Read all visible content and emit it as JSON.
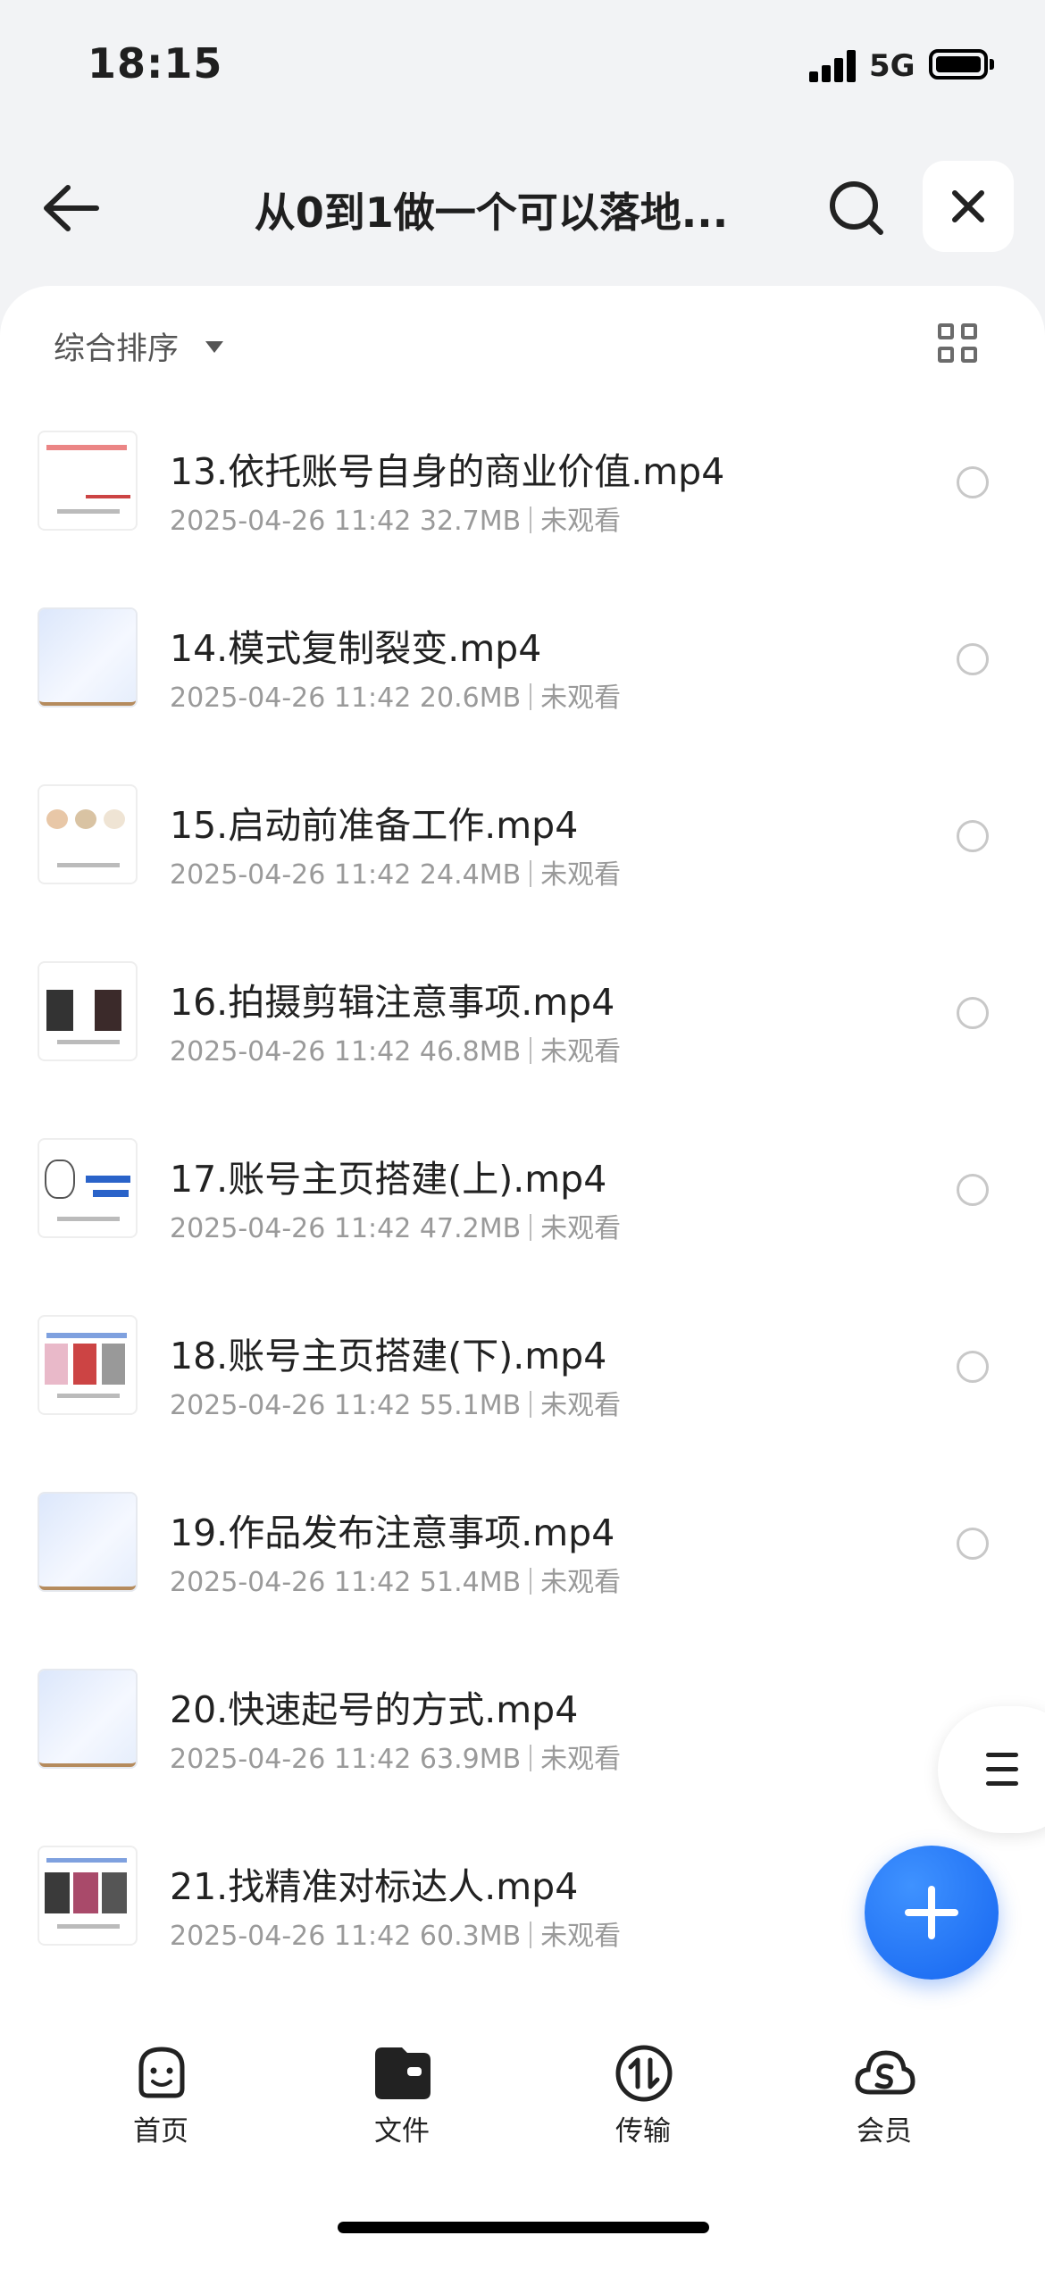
{
  "status": {
    "time": "18:15",
    "network": "5G"
  },
  "header": {
    "title": "从0到1做一个可以落地...",
    "back_icon": "arrow-left-icon",
    "search_icon": "search-icon",
    "close_icon": "close-icon"
  },
  "toolbar": {
    "sort_label": "综合排序"
  },
  "files": [
    {
      "name": "13.依托账号自身的商业价值.mp4",
      "date": "2025-04-26 11:42",
      "size": "32.7MB",
      "status": "未观看"
    },
    {
      "name": "14.模式复制裂变.mp4",
      "date": "2025-04-26 11:42",
      "size": "20.6MB",
      "status": "未观看"
    },
    {
      "name": "15.启动前准备工作.mp4",
      "date": "2025-04-26 11:42",
      "size": "24.4MB",
      "status": "未观看"
    },
    {
      "name": "16.拍摄剪辑注意事项.mp4",
      "date": "2025-04-26 11:42",
      "size": "46.8MB",
      "status": "未观看"
    },
    {
      "name": "17.账号主页搭建(上).mp4",
      "date": "2025-04-26 11:42",
      "size": "47.2MB",
      "status": "未观看"
    },
    {
      "name": "18.账号主页搭建(下).mp4",
      "date": "2025-04-26 11:42",
      "size": "55.1MB",
      "status": "未观看"
    },
    {
      "name": "19.作品发布注意事项.mp4",
      "date": "2025-04-26 11:42",
      "size": "51.4MB",
      "status": "未观看"
    },
    {
      "name": "20.快速起号的方式.mp4",
      "date": "2025-04-26 11:42",
      "size": "63.9MB",
      "status": "未观看"
    },
    {
      "name": "21.找精准对标达人.mp4",
      "date": "2025-04-26 11:42",
      "size": "60.3MB",
      "status": "未观看"
    }
  ],
  "tabs": [
    {
      "label": "首页",
      "icon": "smiley-face-icon"
    },
    {
      "label": "文件",
      "icon": "folder-icon"
    },
    {
      "label": "传输",
      "icon": "transfer-icon"
    },
    {
      "label": "会员",
      "icon": "cloud-vip-icon"
    }
  ],
  "colors": {
    "accent": "#1565f0",
    "muted_text": "#9a9a9a"
  }
}
